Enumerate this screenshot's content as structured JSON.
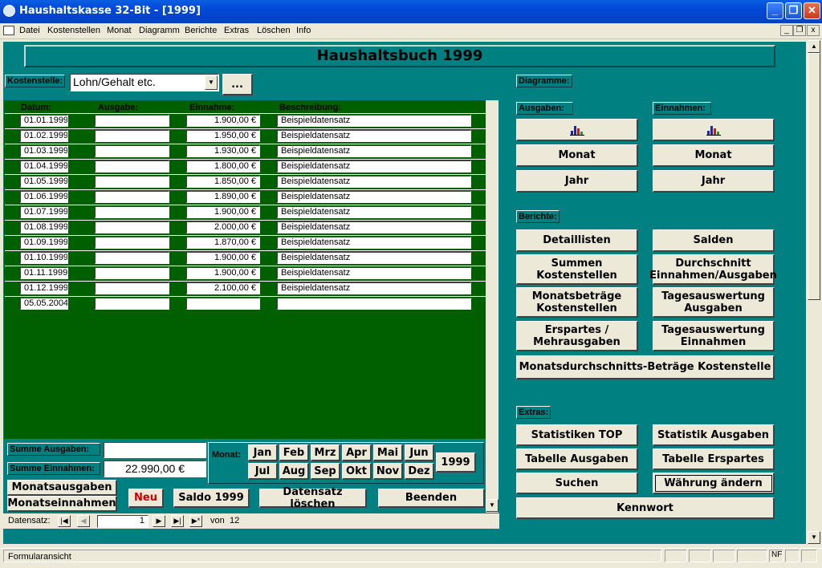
{
  "window": {
    "title": "Haushaltskasse 32-Bit - [1999]",
    "minimize": "_",
    "maximize": "❐",
    "close": "✕"
  },
  "menu": [
    "Datei",
    "Kostenstellen",
    "Monat",
    "Diagramm",
    "Berichte",
    "Extras",
    "Löschen",
    "Info"
  ],
  "form": {
    "title": "Haushaltsbuch 1999",
    "kostenstelle_label": "Kostenstelle:",
    "kostenstelle_value": "Lohn/Gehalt etc.",
    "ellipsis_button": "...",
    "grid": {
      "headers": [
        "Datum:",
        "Ausgabe:",
        "Einnahme:",
        "Beschreibung:"
      ],
      "rows": [
        [
          "01.01.1999",
          "",
          "1.900,00 €",
          "Beispieldatensatz"
        ],
        [
          "01.02.1999",
          "",
          "1.950,00 €",
          "Beispieldatensatz"
        ],
        [
          "01.03.1999",
          "",
          "1.930,00 €",
          "Beispieldatensatz"
        ],
        [
          "01.04.1999",
          "",
          "1.800,00 €",
          "Beispieldatensatz"
        ],
        [
          "01.05.1999",
          "",
          "1.850,00 €",
          "Beispieldatensatz"
        ],
        [
          "01.06.1999",
          "",
          "1.890,00 €",
          "Beispieldatensatz"
        ],
        [
          "01.07.1999",
          "",
          "1.900,00 €",
          "Beispieldatensatz"
        ],
        [
          "01.08.1999",
          "",
          "2.000,00 €",
          "Beispieldatensatz"
        ],
        [
          "01.09.1999",
          "",
          "1.870,00 €",
          "Beispieldatensatz"
        ],
        [
          "01.10.1999",
          "",
          "1.900,00 €",
          "Beispieldatensatz"
        ],
        [
          "01.11.1999",
          "",
          "1.900,00 €",
          "Beispieldatensatz"
        ],
        [
          "01.12.1999",
          "",
          "2.100,00 €",
          "Beispieldatensatz"
        ],
        [
          "05.05.2004",
          "",
          "",
          ""
        ]
      ]
    },
    "summe_ausgaben_label": "Summe Ausgaben:",
    "summe_ausgaben_value": "",
    "summe_einnahmen_label": "Summe Einnahmen:",
    "summe_einnahmen_value": "22.990,00 €",
    "monat_label": "Monat:",
    "months": [
      "Jan",
      "Feb",
      "Mrz",
      "Apr",
      "Mai",
      "Jun",
      "Jul",
      "Aug",
      "Sep",
      "Okt",
      "Nov",
      "Dez"
    ],
    "year_button": "1999",
    "monatsausgaben": "Monatsausgaben",
    "monatseinnahmen": "Monatseinnahmen",
    "neu": "Neu",
    "saldo": "Saldo 1999",
    "datensatz_loeschen": "Datensatz löschen",
    "beenden": "Beenden",
    "diagramme_label": "Diagramme:",
    "ausgaben_label": "Ausgaben:",
    "einnahmen_label": "Einnahmen:",
    "monat_btn": "Monat",
    "jahr_btn": "Jahr",
    "berichte_label": "Berichte:",
    "berichte": {
      "detaillisten": "Detaillisten",
      "salden": "Salden",
      "summen1": "Summen",
      "summen2": "Kostenstellen",
      "durchschnitt1": "Durchschnitt",
      "durchschnitt2": "Einnahmen/Ausgaben",
      "monatsbetraege1": "Monatsbeträge",
      "monatsbetraege2": "Kostenstellen",
      "tages_ausg1": "Tagesauswertung",
      "tages_ausg2": "Ausgaben",
      "erspartes1": "Erspartes /",
      "erspartes2": "Mehrausgaben",
      "tages_einn1": "Tagesauswertung",
      "tages_einn2": "Einnahmen",
      "monatsdurchschnitt": "Monatsdurchschnitts-Beträge Kostenstelle"
    },
    "extras_label": "Extras:",
    "extras": {
      "statistiken_top": "Statistiken TOP",
      "statistik_ausgaben": "Statistik Ausgaben",
      "tabelle_ausgaben": "Tabelle Ausgaben",
      "tabelle_erspartes": "Tabelle Erspartes",
      "suchen": "Suchen",
      "waehrung": "Währung ändern",
      "kennwort": "Kennwort"
    }
  },
  "navigation": {
    "label": "Datensatz:",
    "current": "1",
    "of_text": "von",
    "total": "12"
  },
  "status": {
    "text": "Formularansicht",
    "nf": "NF"
  },
  "colors": {
    "teal": "#008080",
    "grid_green": "#006000",
    "titlebar_blue": "#0048d8",
    "neu_red": "#cc0000"
  }
}
